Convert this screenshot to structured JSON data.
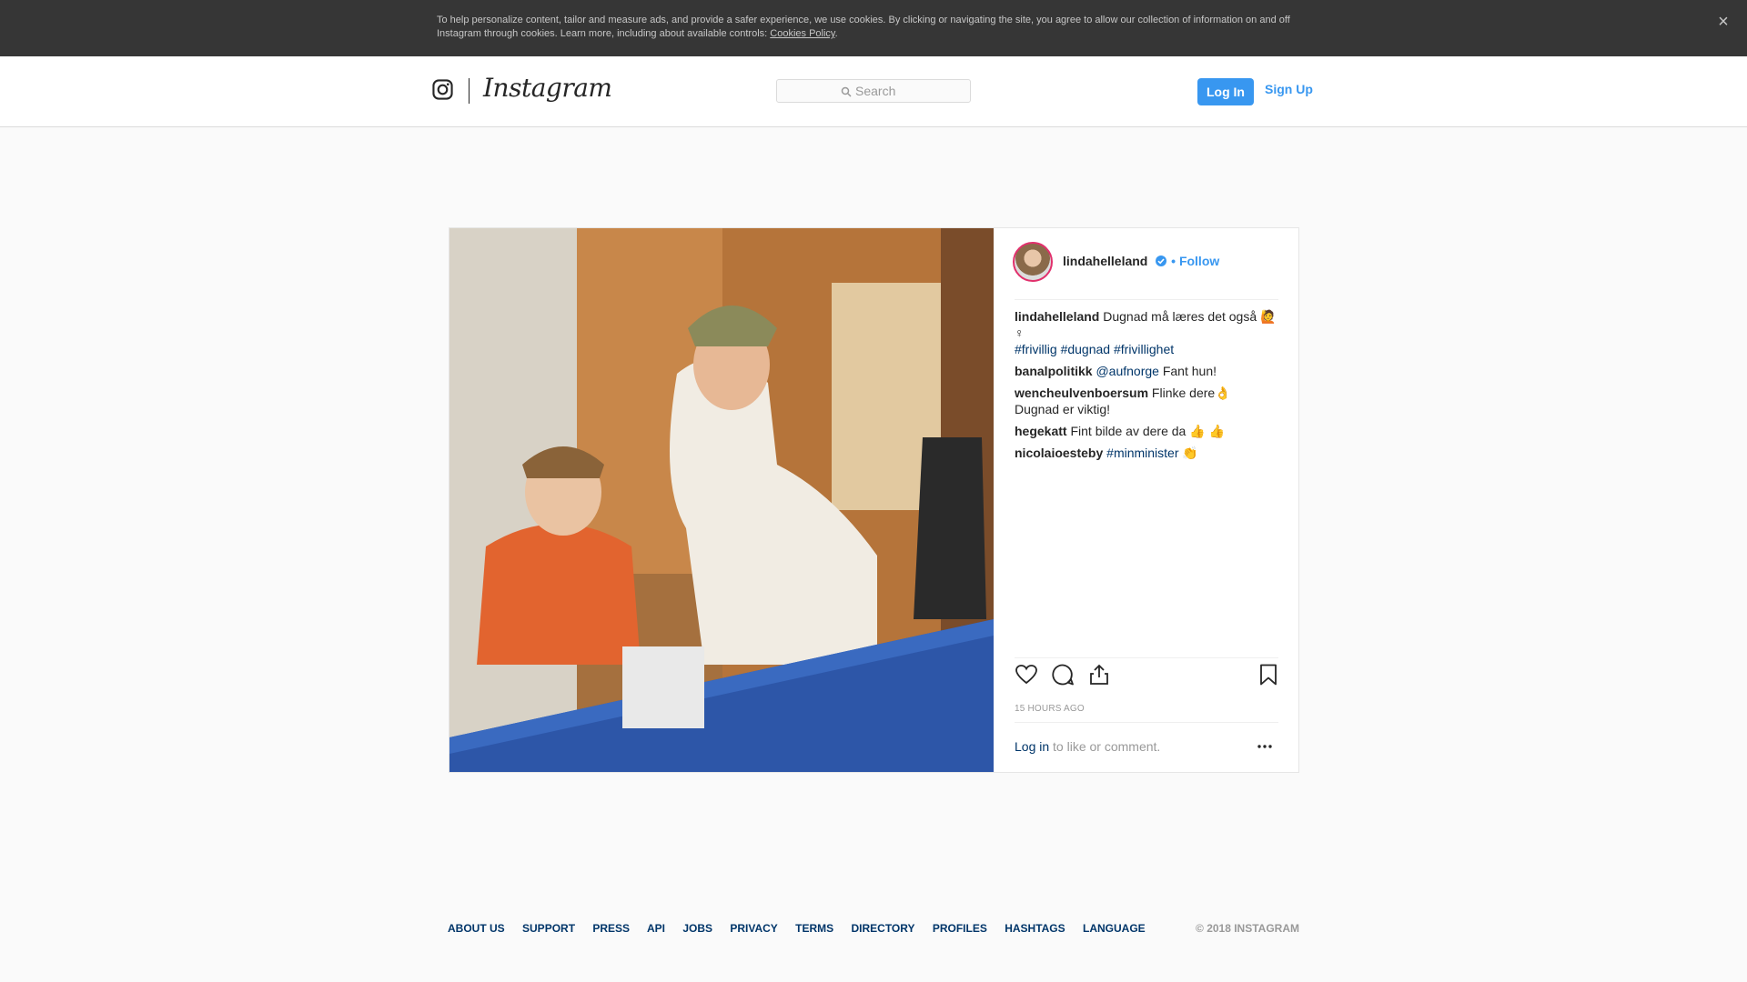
{
  "cookie_banner": {
    "text": "To help personalize content, tailor and measure ads, and provide a safer experience, we use cookies. By clicking or navigating the site, you agree to allow our collection of information on and off Instagram through cookies. Learn more, including about available controls: ",
    "link": "Cookies Policy",
    "close": "×"
  },
  "header": {
    "brand": "Instagram",
    "search_placeholder": "Search",
    "login_label": "Log In",
    "signup_label": "Sign Up"
  },
  "post": {
    "owner": "lindahelleland",
    "separator": " • ",
    "follow_label": "Follow",
    "caption": {
      "user": "lindahelleland",
      "text": " Dugnad må læres det også 🙋 ♀",
      "hashtags": [
        "#frivillig",
        "#dugnad",
        "#frivillighet"
      ]
    },
    "comments": [
      {
        "user": "banalpolitikk",
        "mention": "@aufnorge",
        "text": " Fant hun!"
      },
      {
        "user": "wencheulvenboersum",
        "text": " Flinke dere👌 Dugnad er viktig!"
      },
      {
        "user": "hegekatt",
        "text": " Fint bilde av dere da 👍 👍"
      },
      {
        "user": "nicolaioesteby",
        "mention": "#minminister",
        "text": " 👏"
      }
    ],
    "timestamp": "15 HOURS AGO",
    "login_link": "Log in",
    "login_suffix": " to like or comment."
  },
  "footer": {
    "links": [
      "ABOUT US",
      "SUPPORT",
      "PRESS",
      "API",
      "JOBS",
      "PRIVACY",
      "TERMS",
      "DIRECTORY",
      "PROFILES",
      "HASHTAGS",
      "LANGUAGE"
    ],
    "copyright": "© 2018 INSTAGRAM"
  },
  "colors": {
    "accent": "#3897f0",
    "link_dark": "#003569",
    "banner_bg": "#363636"
  }
}
